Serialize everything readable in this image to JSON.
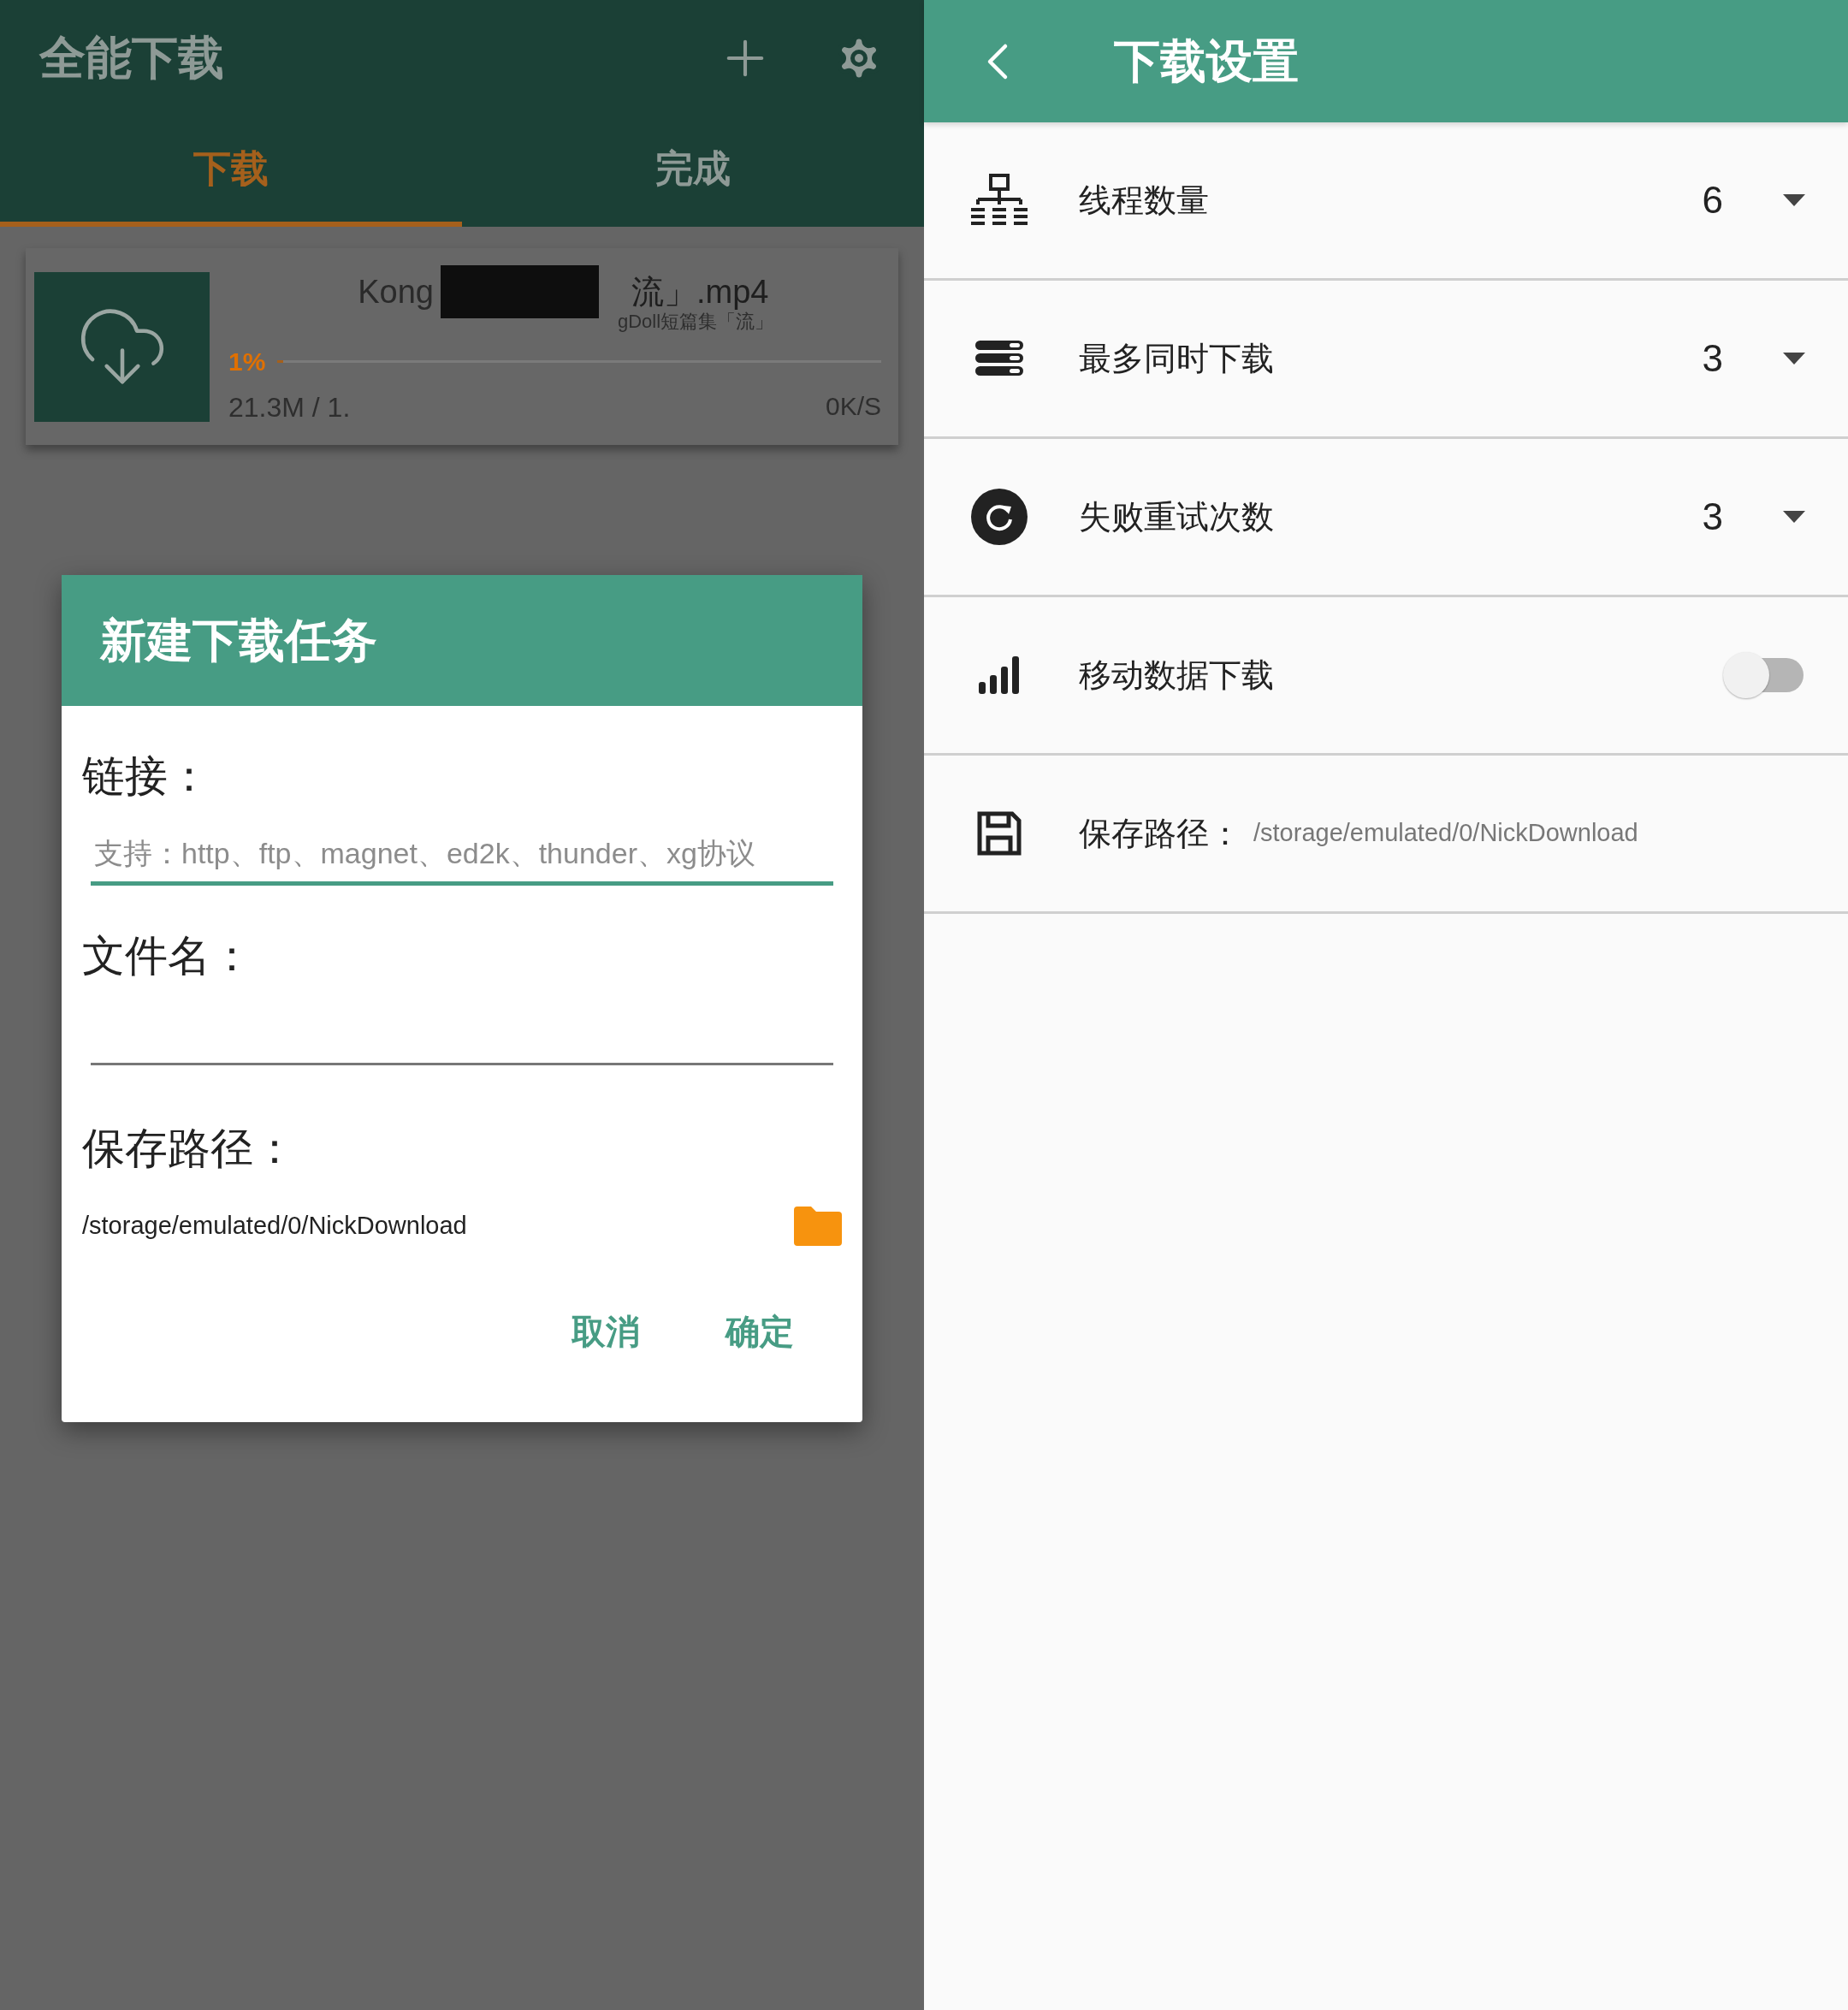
{
  "left": {
    "app_bar": {
      "title": "全能下载"
    },
    "tabs": [
      {
        "label": "下载",
        "selected": true
      },
      {
        "label": "完成",
        "selected": false
      }
    ],
    "download_card": {
      "name_start": "Kong",
      "name_end": "流」.mp4",
      "subtitle": "gDoll短篇集「流」",
      "percent": "1%",
      "level": 0.01,
      "size": "21.3M / 1.",
      "speed": "0K/S"
    },
    "dialog": {
      "title": "新建下载任务",
      "fields": [
        {
          "label": "链接：",
          "placeholder": "支持：http、ftp、magnet、ed2k、thunder、xg协议",
          "focused": true
        },
        {
          "label": "文件名：",
          "focused": false
        }
      ],
      "save_label": "保存路径：",
      "save_path": "/storage/emulated/0/NickDownload",
      "buttons": [
        "取消",
        "确定"
      ]
    }
  },
  "right": {
    "app_bar": {
      "title": "下载设置"
    },
    "settings": [
      {
        "kind": "dropdown",
        "label": "线程数量",
        "value": "6"
      },
      {
        "kind": "dropdown",
        "label": "最多同时下载",
        "value": "3"
      },
      {
        "kind": "dropdown",
        "label": "失败重试次数",
        "value": "3"
      },
      {
        "kind": "toggle",
        "label": "移动数据下载",
        "on": false
      },
      {
        "kind": "path",
        "label": "保存路径：",
        "value": "/storage/emulated/0/NickDownload"
      }
    ]
  }
}
